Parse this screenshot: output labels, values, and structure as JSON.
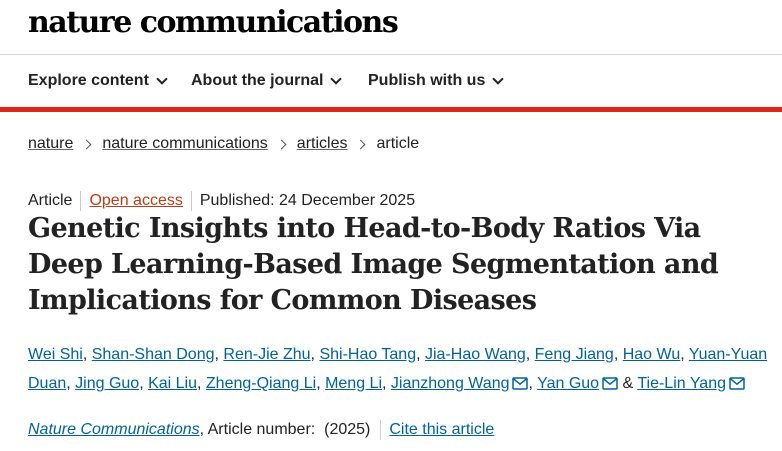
{
  "header": {
    "logo": "nature communications"
  },
  "nav": {
    "items": [
      {
        "label": "Explore content"
      },
      {
        "label": "About the journal"
      },
      {
        "label": "Publish with us"
      }
    ]
  },
  "breadcrumb": [
    "nature",
    "nature communications",
    "articles",
    "article"
  ],
  "article": {
    "type": "Article",
    "access": "Open access",
    "published": "Published: 24 December 2025",
    "title": "Genetic Insights into Head-to-Body Ratios Via Deep Learning-Based Image Segmentation and Implications for Common Diseases",
    "authors": [
      "Wei Shi",
      "Shan-Shan Dong",
      "Ren-Jie Zhu",
      "Shi-Hao Tang",
      "Jia-Hao Wang",
      "Feng Jiang",
      "Hao Wu",
      "Yuan-Yuan Duan",
      "Jing Guo",
      "Kai Liu",
      "Zheng-Qiang Li",
      "Meng Li",
      "Jianzhong Wang",
      "Yan Guo",
      "Tie-Lin Yang"
    ],
    "journal": "Nature Communications",
    "article_number": ", Article number:  (2025)",
    "cite": "Cite this article"
  },
  "colors": {
    "accent_red": "#e0251b",
    "link_blue": "#046196",
    "open_access": "#b3401a"
  }
}
